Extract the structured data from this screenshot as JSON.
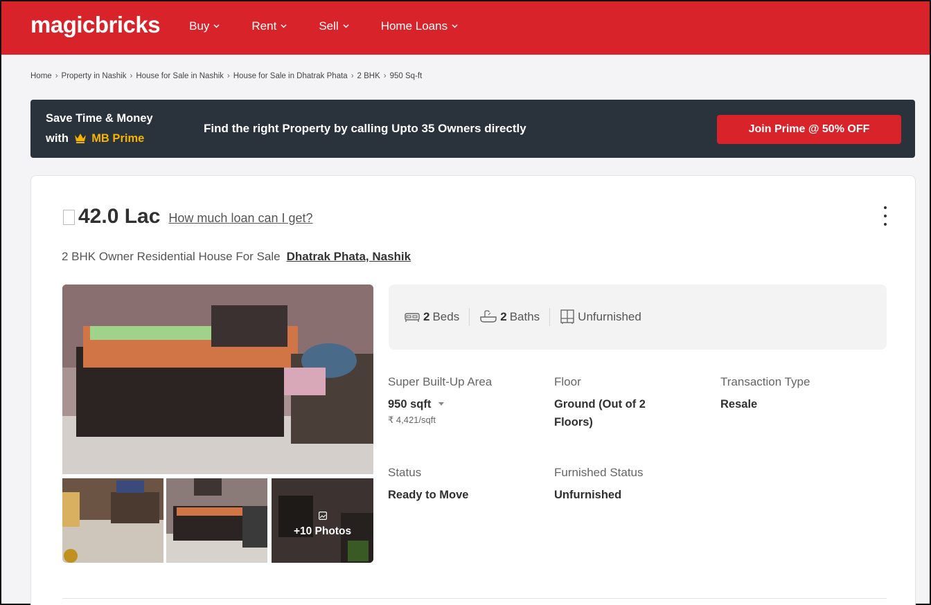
{
  "header": {
    "logo": "magicbricks",
    "nav": [
      {
        "label": "Buy"
      },
      {
        "label": "Rent"
      },
      {
        "label": "Sell"
      },
      {
        "label": "Home Loans"
      }
    ]
  },
  "breadcrumb": [
    "Home",
    "Property in Nashik",
    "House for Sale in Nashik",
    "House for Sale in Dhatrak Phata",
    "2 BHK",
    "950 Sq-ft"
  ],
  "promo": {
    "line1": "Save Time & Money",
    "line2_prefix": "with",
    "brand": "MB Prime",
    "message": "Find the right Property by calling Upto 35 Owners directly",
    "button": "Join Prime @ 50% OFF"
  },
  "listing": {
    "currency_symbol": "₹",
    "price": "42.0 Lac",
    "loan_link": "How much loan can I get?",
    "subtitle": "2 BHK Owner Residential House For Sale",
    "location": "Dhatrak Phata, Nashik",
    "more_photos": "+10 Photos",
    "amenities": {
      "beds_count": "2",
      "beds_label": "Beds",
      "baths_count": "2",
      "baths_label": "Baths",
      "furnishing": "Unfurnished"
    },
    "details": {
      "area_label": "Super Built-Up Area",
      "area_value": "950 sqft",
      "price_per_sqft": "₹ 4,421/sqft",
      "floor_label": "Floor",
      "floor_value": "Ground (Out of 2 Floors)",
      "transaction_label": "Transaction Type",
      "transaction_value": "Resale",
      "status_label": "Status",
      "status_value": "Ready to Move",
      "furnished_label": "Furnished Status",
      "furnished_value": "Unfurnished"
    }
  },
  "colors": {
    "brand_red": "#d8232a",
    "promo_bg": "#2a323c",
    "prime_gold": "#f6b400"
  }
}
